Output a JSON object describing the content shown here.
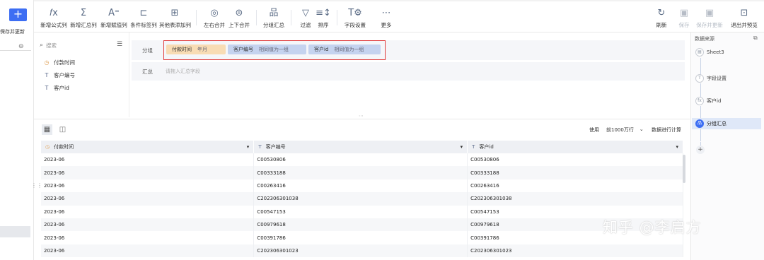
{
  "left_strip": {
    "add_label": "+",
    "save_update": "保存并更新"
  },
  "toolbar": {
    "items": [
      {
        "icon": "fx-icon",
        "glyph": "𝑓x",
        "label": "新增公式列"
      },
      {
        "icon": "sigma-icon",
        "glyph": "Σ",
        "label": "新增汇总列"
      },
      {
        "icon": "assign-icon",
        "glyph": "A⁼",
        "label": "新增赋值列"
      },
      {
        "icon": "condition-icon",
        "glyph": "⊏",
        "label": "条件标签列"
      },
      {
        "icon": "other-table-icon",
        "glyph": "⊞",
        "label": "其他表添加列"
      },
      {
        "icon": "merge-lr-icon",
        "glyph": "◎",
        "label": "左右合并"
      },
      {
        "icon": "merge-ud-icon",
        "glyph": "⊜",
        "label": "上下合并"
      },
      {
        "icon": "group-sum-icon",
        "glyph": "品",
        "label": "分组汇总"
      },
      {
        "icon": "filter-icon",
        "glyph": "▽",
        "label": "过滤"
      },
      {
        "icon": "sort-icon",
        "glyph": "≡↕",
        "label": "排序"
      },
      {
        "icon": "field-setting-icon",
        "glyph": "T⚙",
        "label": "字段设置"
      },
      {
        "icon": "more-icon",
        "glyph": "⋯",
        "label": "更多"
      }
    ],
    "right_items": [
      {
        "icon": "refresh-icon",
        "glyph": "↻",
        "label": "刷新"
      },
      {
        "icon": "save-icon",
        "glyph": "▣",
        "label": "保存"
      },
      {
        "icon": "save-update-icon",
        "glyph": "▣",
        "label": "保存并更新"
      },
      {
        "icon": "exit-preview-icon",
        "glyph": "⊡",
        "label": "退出并预览"
      }
    ]
  },
  "field_panel": {
    "search_placeholder": "搜索",
    "fields": [
      {
        "type_icon": "clock-icon",
        "glyph": "◷",
        "name": "付款时间"
      },
      {
        "type_icon": "text-type-icon",
        "glyph": "T",
        "name": "客户编号"
      },
      {
        "type_icon": "text-type-icon",
        "glyph": "T",
        "name": "客户id"
      }
    ]
  },
  "config": {
    "group_label": "分组",
    "group_tags": [
      {
        "field": "付款时间",
        "value": "年月",
        "color": "#f8dcb4"
      },
      {
        "field": "客户编号",
        "value": "相同值为一组",
        "color": "#c5d3ef"
      },
      {
        "field": "客户id",
        "value": "相同值为一组",
        "color": "#c5d3ef"
      }
    ],
    "summary_label": "汇总",
    "summary_placeholder": "请拖入汇总字段"
  },
  "table_toolbar": {
    "use_label": "使用",
    "rows_option": "前1000万行",
    "compute_label": "数据进行计算"
  },
  "table": {
    "columns": [
      {
        "icon": "clock-icon",
        "glyph": "◷",
        "name": "付款时间"
      },
      {
        "icon": "text-type-icon",
        "glyph": "T",
        "name": "客户编号"
      },
      {
        "icon": "text-type-icon",
        "glyph": "T",
        "name": "客户id"
      }
    ],
    "rows": [
      [
        "2023-06",
        "C00530806",
        "C00530806"
      ],
      [
        "2023-06",
        "C00333188",
        "C00333188"
      ],
      [
        "2023-06",
        "C00263416",
        "C00263416"
      ],
      [
        "2023-06",
        "C202306301038",
        "C202306301038"
      ],
      [
        "2023-06",
        "C00547153",
        "C00547153"
      ],
      [
        "2023-06",
        "C00979618",
        "C00979618"
      ],
      [
        "2023-06",
        "C00391786",
        "C00391786"
      ],
      [
        "2023-06",
        "C202306301023",
        "C202306301023"
      ]
    ]
  },
  "right_panel": {
    "title": "数据来源",
    "steps": [
      "Sheet3",
      "字段设置",
      "客户id",
      "分组汇总"
    ]
  },
  "watermark": "知乎 @李启方"
}
